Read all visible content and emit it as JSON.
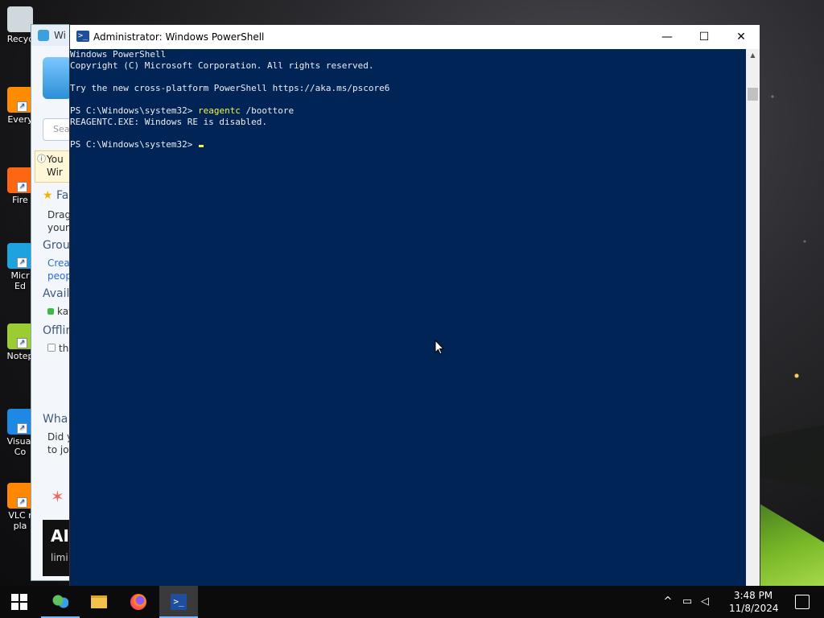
{
  "desktop": {
    "icons": [
      {
        "label": "Recycle Bin",
        "visible_label": "Recyc",
        "color": "#cfd8dc"
      },
      {
        "label": "Everything",
        "visible_label": "Every",
        "color": "#ff8c00"
      },
      {
        "label": "Firefox",
        "visible_label": "Fire",
        "color": "#ff6611"
      },
      {
        "label": "Microsoft Edge",
        "visible_label": "Micr\nEd",
        "color": "#1fa3e0"
      },
      {
        "label": "Notepad++",
        "visible_label": "Notep",
        "color": "#9acd32"
      },
      {
        "label": "Visual Studio Code",
        "visible_label": "Visual\nCo",
        "color": "#1e88e5"
      },
      {
        "label": "VLC media player",
        "visible_label": "VLC r\npla",
        "color": "#ff8800"
      }
    ]
  },
  "messenger": {
    "title": "Wi",
    "search_placeholder": "Sea",
    "warning": "You\nWir",
    "favorites_heading": "Fa",
    "favorites_hint": "Drag\nyour",
    "groups_heading": "Grou",
    "groups_hint": "Creat\npeop",
    "available_heading": "Avail",
    "available_contact": "kay",
    "offline_heading": "Offlin",
    "offline_contact": "tha",
    "whats_new_heading": "Wha",
    "whats_new_text": "Did yo\nto joi",
    "ad_text": "AI",
    "ad_small": "limi"
  },
  "powershell": {
    "title": "Administrator: Windows PowerShell",
    "icon_glyph": ">_",
    "controls": {
      "minimize": "—",
      "maximize": "☐",
      "close": "✕"
    },
    "console_lines": [
      {
        "text": "Windows PowerShell"
      },
      {
        "text": "Copyright (C) Microsoft Corporation. All rights reserved."
      },
      {
        "text": ""
      },
      {
        "text": "Try the new cross-platform PowerShell https://aka.ms/pscore6"
      },
      {
        "text": ""
      },
      {
        "prompt": "PS C:\\Windows\\system32> ",
        "command": "reagentc",
        "args": " /boottore"
      },
      {
        "text": "REAGENTC.EXE: Windows RE is disabled."
      },
      {
        "text": ""
      },
      {
        "prompt": "PS C:\\Windows\\system32> ",
        "command": "",
        "args": ""
      }
    ],
    "colors": {
      "background": "#012456",
      "text": "#eeedf0",
      "command": "#f5f543"
    }
  },
  "taskbar": {
    "apps": [
      {
        "name": "start-button",
        "label": "Start"
      },
      {
        "name": "messenger-taskbar-button",
        "label": "Windows Live Messenger"
      },
      {
        "name": "file-explorer-taskbar-button",
        "label": "File Explorer"
      },
      {
        "name": "firefox-taskbar-button",
        "label": "Firefox"
      },
      {
        "name": "powershell-taskbar-button",
        "label": "Windows PowerShell",
        "active": true
      }
    ],
    "tray": {
      "overflow": "^",
      "network": "network-icon",
      "volume": "volume-muted-icon"
    },
    "clock": {
      "time": "3:48 PM",
      "date": "11/8/2024"
    }
  }
}
